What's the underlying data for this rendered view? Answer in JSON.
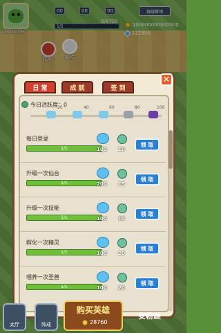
{
  "hud": {
    "player_name": "ceshi009",
    "slot1": "00",
    "slot2": "00",
    "slot3": "00",
    "challenge_label": "挑战首领",
    "progress": "1/5",
    "exp": "0/4750",
    "gold": "100000000000000",
    "gems": "122300"
  },
  "map_buttons": [
    {
      "label": "福利"
    },
    {
      "label": "邮件"
    }
  ],
  "tabs": [
    {
      "label": "日 常",
      "active": true
    },
    {
      "label": "成 就",
      "active": false
    },
    {
      "label": "签 到",
      "active": false
    }
  ],
  "activity": {
    "label": "今日活跃度：0",
    "markers": [
      "20",
      "40",
      "60",
      "80",
      "100"
    ]
  },
  "tasks": [
    {
      "title": "每日登录",
      "progress": "1/1",
      "gems": "100",
      "orb": "10",
      "claim": "领 取"
    },
    {
      "title": "升级一次仙台",
      "progress": "1/1",
      "gems": "200",
      "orb": "15",
      "claim": "领 取"
    },
    {
      "title": "升级一次技能",
      "progress": "1/1",
      "gems": "100",
      "orb": "15",
      "claim": "领 取"
    },
    {
      "title": "孵化一次精灵",
      "progress": "1/1",
      "gems": "100",
      "orb": "20",
      "claim": "领 取"
    },
    {
      "title": "喂养一次圣兽",
      "progress": "1/1",
      "gems": "100",
      "orb": "20",
      "claim": "领 取"
    }
  ],
  "bottom": {
    "left_btn": "太厅",
    "right_btn": "阵成",
    "buy_title": "购买英雄",
    "buy_price": "28760",
    "watermark": "安粉丝"
  },
  "colors": {
    "panel_border": "#6b4a2b",
    "tab_active": "#d2402f",
    "claim_button": "#2b7fd1",
    "progress_fill": "#6fbf3a"
  }
}
